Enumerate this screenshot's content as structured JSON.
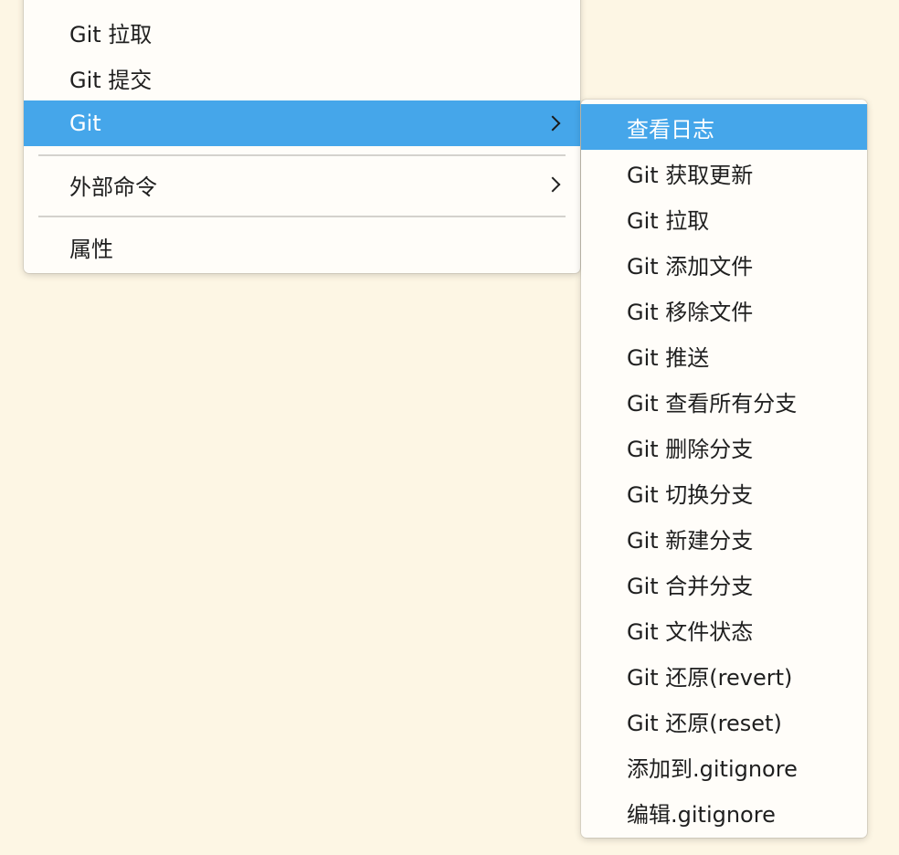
{
  "colors": {
    "background": "#fdf6e4",
    "menu_bg": "#fffdf9",
    "selection": "#45a6ea",
    "separator": "#d4d2cd",
    "text": "#1f1f1f"
  },
  "main_menu": {
    "items": [
      {
        "label": "Git 拉取"
      },
      {
        "label": "Git 提交"
      },
      {
        "label": "Git",
        "selected": true,
        "has_submenu": true
      },
      {
        "label": "外部命令",
        "has_submenu": true
      },
      {
        "label": "属性"
      }
    ]
  },
  "git_submenu": {
    "items": [
      {
        "label": "查看日志",
        "selected": true
      },
      {
        "label": "Git 获取更新"
      },
      {
        "label": "Git 拉取"
      },
      {
        "label": "Git 添加文件"
      },
      {
        "label": "Git 移除文件"
      },
      {
        "label": "Git 推送"
      },
      {
        "label": "Git 查看所有分支"
      },
      {
        "label": "Git 删除分支"
      },
      {
        "label": "Git 切换分支"
      },
      {
        "label": "Git 新建分支"
      },
      {
        "label": "Git 合并分支"
      },
      {
        "label": "Git 文件状态"
      },
      {
        "label": "Git 还原(revert)"
      },
      {
        "label": "Git 还原(reset)"
      },
      {
        "label": "添加到.gitignore"
      },
      {
        "label": "编辑.gitignore"
      }
    ]
  }
}
